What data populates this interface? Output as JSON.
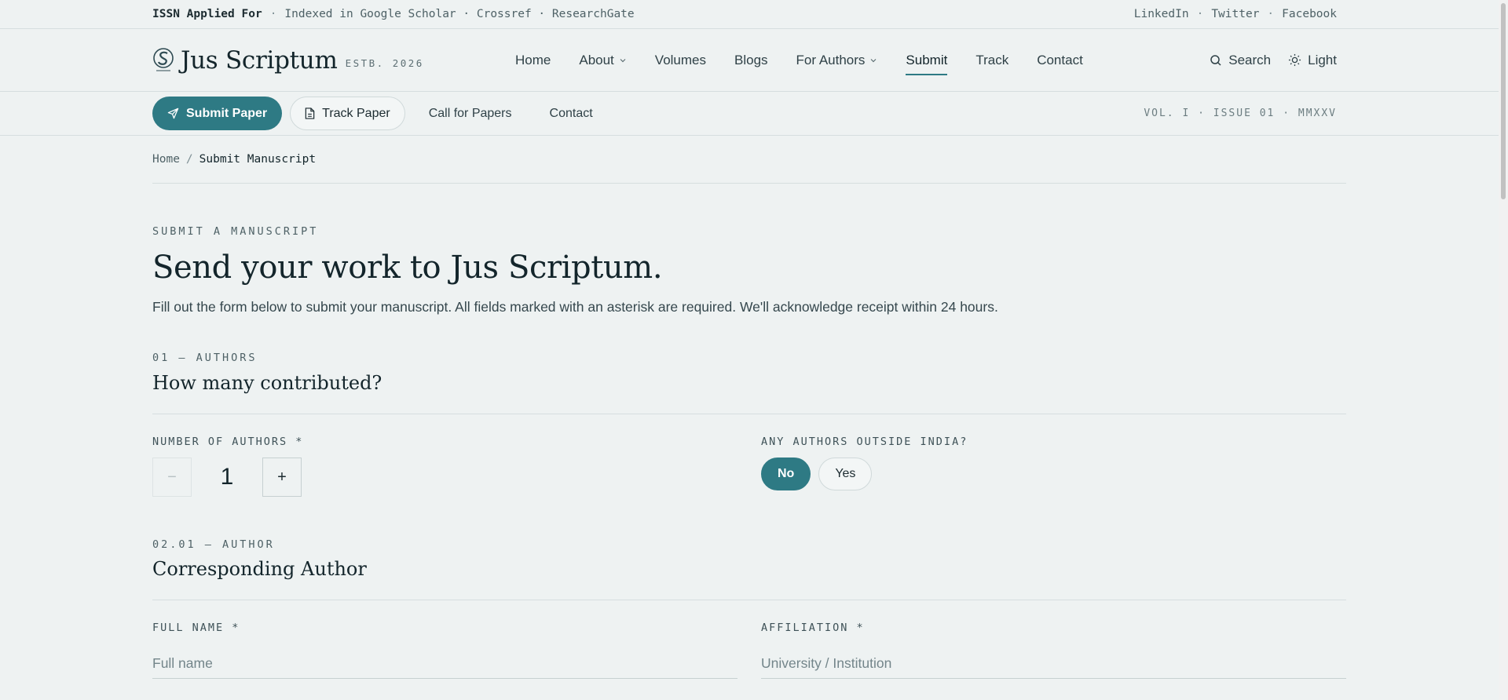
{
  "topbar": {
    "issn": "ISSN Applied For",
    "dot": "·",
    "indexed": "Indexed in Google Scholar · Crossref · ResearchGate",
    "social": [
      "LinkedIn",
      "Twitter",
      "Facebook"
    ]
  },
  "brand": {
    "name": "Jus Scriptum",
    "est": "ESTB. 2026"
  },
  "nav": {
    "items": [
      {
        "label": "Home"
      },
      {
        "label": "About"
      },
      {
        "label": "Volumes"
      },
      {
        "label": "Blogs"
      },
      {
        "label": "For Authors"
      },
      {
        "label": "Submit"
      },
      {
        "label": "Track"
      },
      {
        "label": "Contact"
      }
    ],
    "search": "Search",
    "theme": "Light"
  },
  "actionbar": {
    "submit_paper": "Submit Paper",
    "track_paper": "Track Paper",
    "call_for_papers": "Call for Papers",
    "contact": "Contact",
    "volume": "VOL. I · ISSUE 01 · MMXXV"
  },
  "breadcrumb": {
    "home": "Home",
    "sep": "/",
    "current": "Submit Manuscript"
  },
  "hero": {
    "eyebrow": "SUBMIT A MANUSCRIPT",
    "title": "Send your work to Jus Scriptum.",
    "lead": "Fill out the form below to submit your manuscript. All fields marked with an asterisk are required. We'll acknowledge receipt within 24 hours."
  },
  "section1": {
    "eyebrow": "01 — AUTHORS",
    "title": "How many contributed?",
    "num_authors_label": "NUMBER OF AUTHORS *",
    "minus": "−",
    "num_authors_value": "1",
    "plus": "+",
    "outside_label": "ANY AUTHORS OUTSIDE INDIA?",
    "opt_no": "No",
    "opt_yes": "Yes"
  },
  "section2": {
    "eyebrow": "02.01 — AUTHOR",
    "title": "Corresponding Author",
    "fullname_label": "FULL NAME *",
    "fullname_placeholder": "Full name",
    "affiliation_label": "AFFILIATION *",
    "affiliation_placeholder": "University / Institution"
  }
}
